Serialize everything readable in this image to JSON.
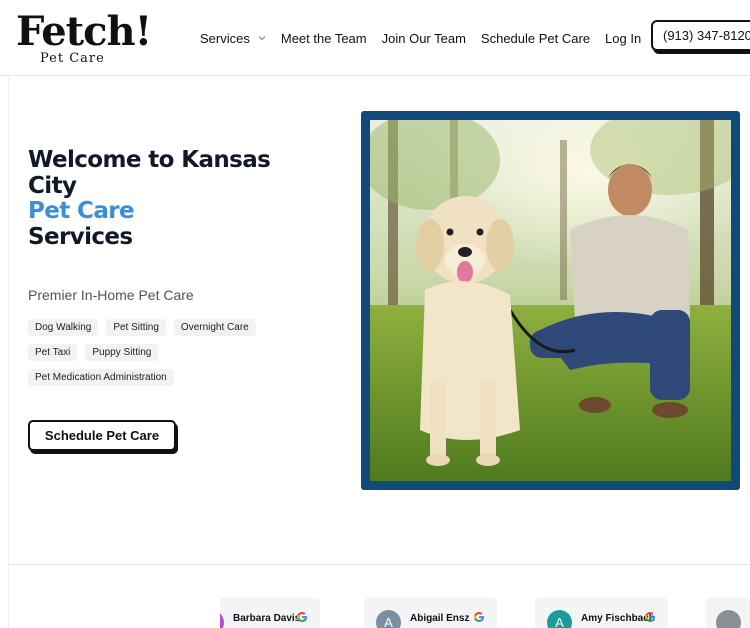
{
  "header": {
    "logo_main": "Fetch!",
    "logo_sub": "Pet Care",
    "nav": [
      {
        "label": "Services",
        "has_dropdown": true
      },
      {
        "label": "Meet the Team"
      },
      {
        "label": "Join Our Team"
      },
      {
        "label": "Schedule Pet Care"
      },
      {
        "label": "Log In"
      }
    ],
    "phone": "(913) 347-8120"
  },
  "hero": {
    "title_line1": "Welcome to Kansas City",
    "title_accent": "Pet Care",
    "title_line3": "Services",
    "subtitle": "Premier In-Home Pet Care",
    "tags": [
      "Dog Walking",
      "Pet Sitting",
      "Overnight Care",
      "Pet Taxi",
      "Puppy Sitting",
      "Pet Medication Administration"
    ],
    "cta_label": "Schedule Pet Care"
  },
  "reviews": [
    {
      "name": "Barbara Davis",
      "initial": "",
      "avatar_color": "#b24fd1"
    },
    {
      "name": "Abigail Ensz",
      "initial": "A",
      "avatar_color": "#7a8fa0"
    },
    {
      "name": "Amy Fischbach",
      "initial": "A",
      "avatar_color": "#1a9c9a"
    }
  ],
  "colors": {
    "accent": "#3b8fd6",
    "frame": "#114a7a",
    "text": "#111827"
  },
  "icons": [
    "location-pin-icon",
    "chevron-down-icon",
    "google-icon"
  ]
}
